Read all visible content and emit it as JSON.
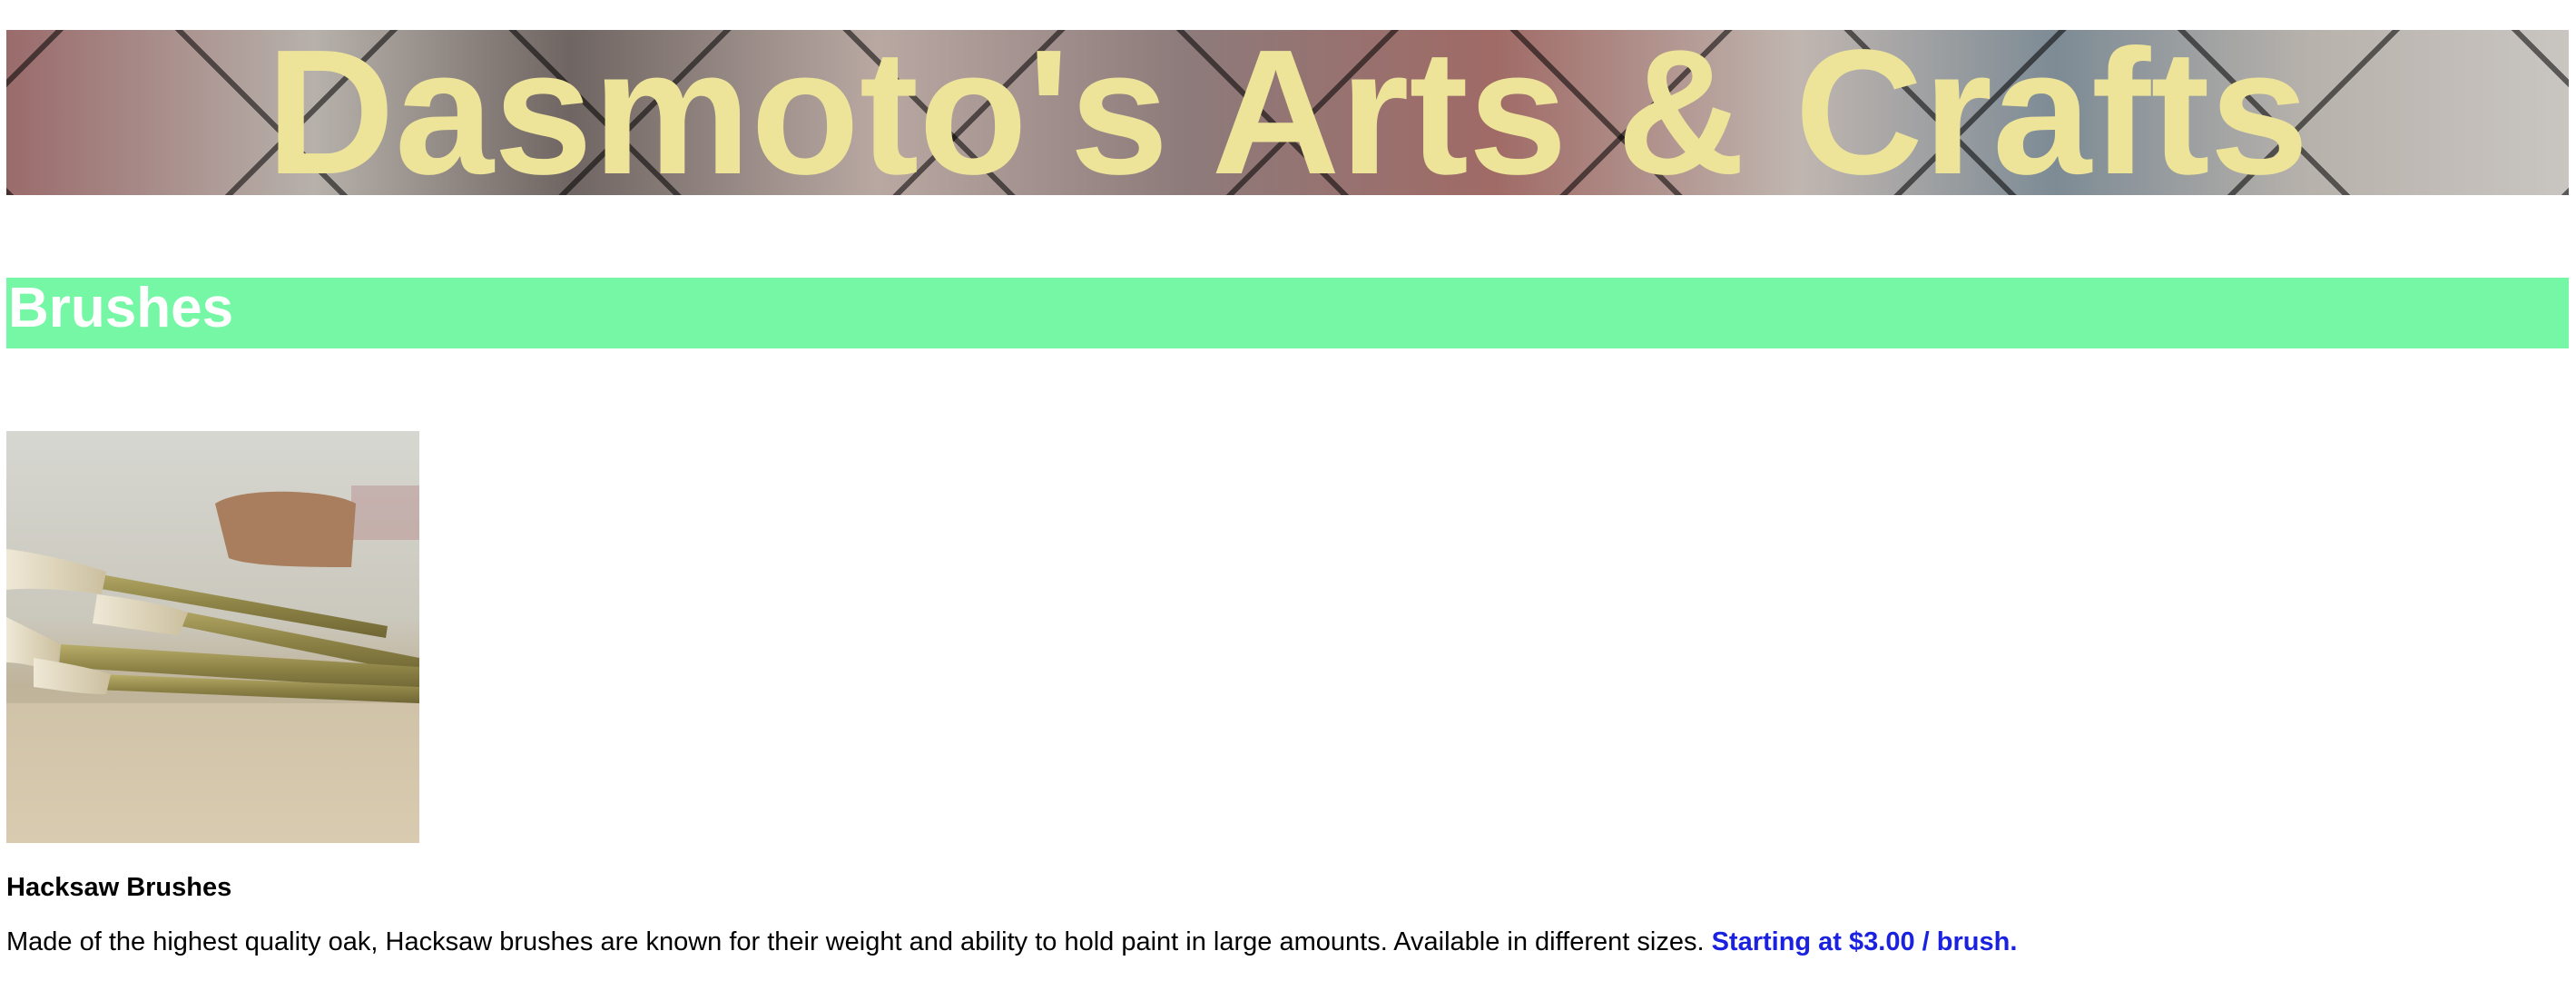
{
  "header": {
    "title": "Dasmoto's Arts & Crafts"
  },
  "section": {
    "title": "Brushes"
  },
  "product": {
    "image_alt": "Hacksaw Brushes",
    "name": "Hacksaw Brushes",
    "description": "Made of the highest quality oak, Hacksaw brushes are known for their weight and ability to hold paint in large amounts. Available in different sizes.",
    "price": "Starting at $3.00 / brush."
  },
  "colors": {
    "title_text": "#ede499",
    "section_band": "#76f7a6",
    "section_text": "#ffffff",
    "price_text": "#1a22e0"
  }
}
